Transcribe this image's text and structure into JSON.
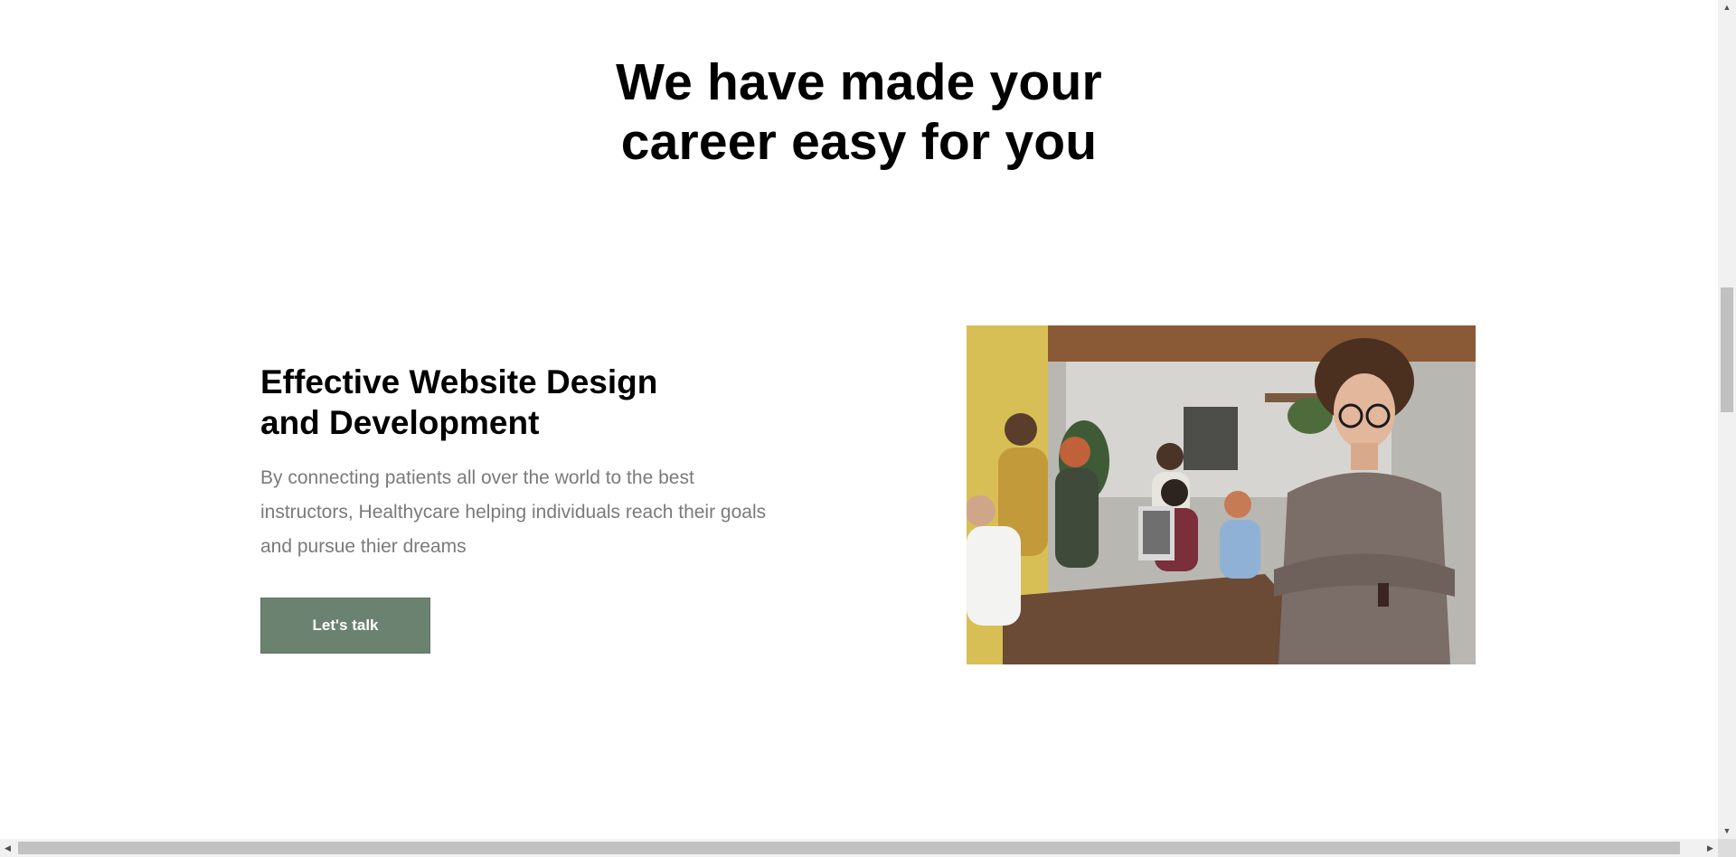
{
  "section": {
    "headline_line1": "We have made your",
    "headline_line2": "career easy for you"
  },
  "feature": {
    "title_line1": "Effective Website Design",
    "title_line2": "and Development",
    "description": "By connecting patients all over the world to the best instructors, Healthycare helping individuals reach their goals and pursue thier dreams",
    "button_label": "Let's talk",
    "image_icon": "team-office-photo"
  },
  "colors": {
    "accent": "#6b8270",
    "body_text": "#7a7a7a",
    "heading": "#000000"
  },
  "scrollbars": {
    "up_icon": "▲",
    "down_icon": "▼",
    "left_icon": "◀",
    "right_icon": "▶"
  }
}
